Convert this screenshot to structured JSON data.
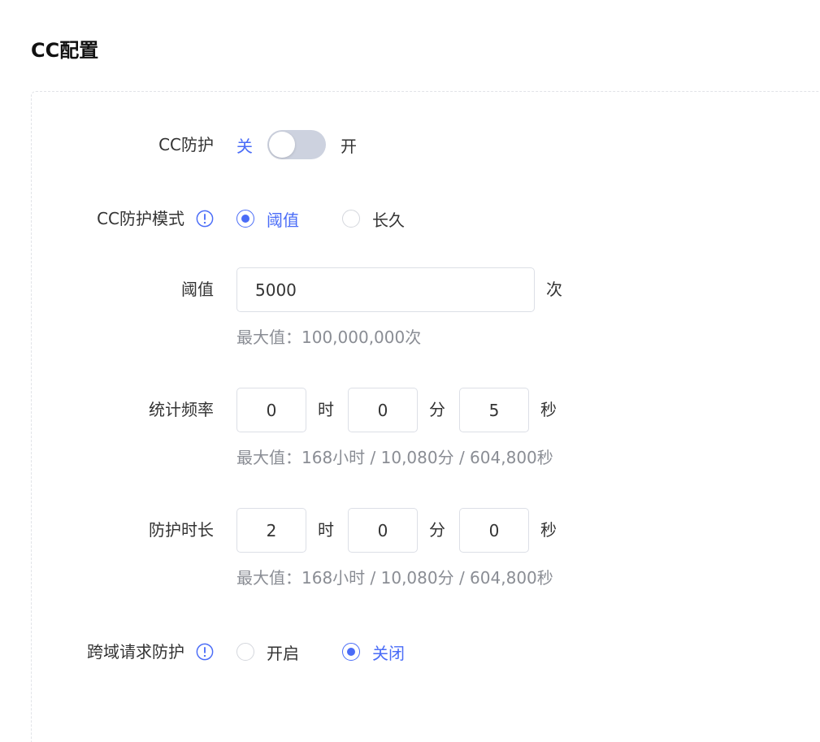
{
  "page": {
    "title": "CC配置"
  },
  "cc_protection": {
    "label": "CC防护",
    "off_label": "关",
    "on_label": "开",
    "enabled": false
  },
  "cc_mode": {
    "label": "CC防护模式",
    "info_icon": "info-icon",
    "options": [
      {
        "label": "阈值",
        "checked": true
      },
      {
        "label": "长久",
        "checked": false
      }
    ]
  },
  "threshold": {
    "label": "阈值",
    "value": "5000",
    "unit": "次",
    "hint": "最大值：100,000,000次"
  },
  "stat_frequency": {
    "label": "统计频率",
    "hours": "0",
    "hours_unit": "时",
    "minutes": "0",
    "minutes_unit": "分",
    "seconds": "5",
    "seconds_unit": "秒",
    "hint": "最大值：168小时 / 10,080分 / 604,800秒"
  },
  "protect_duration": {
    "label": "防护时长",
    "hours": "2",
    "hours_unit": "时",
    "minutes": "0",
    "minutes_unit": "分",
    "seconds": "0",
    "seconds_unit": "秒",
    "hint": "最大值：168小时 / 10,080分 / 604,800秒"
  },
  "cors_protection": {
    "label": "跨域请求防护",
    "info_icon": "info-icon",
    "options": [
      {
        "label": "开启",
        "checked": false
      },
      {
        "label": "关闭",
        "checked": true
      }
    ]
  },
  "colors": {
    "accent": "#4a6cf7",
    "toggle_off_track": "#cdd2df",
    "hint_text": "#8a8d94",
    "border": "#dcdfe6"
  }
}
